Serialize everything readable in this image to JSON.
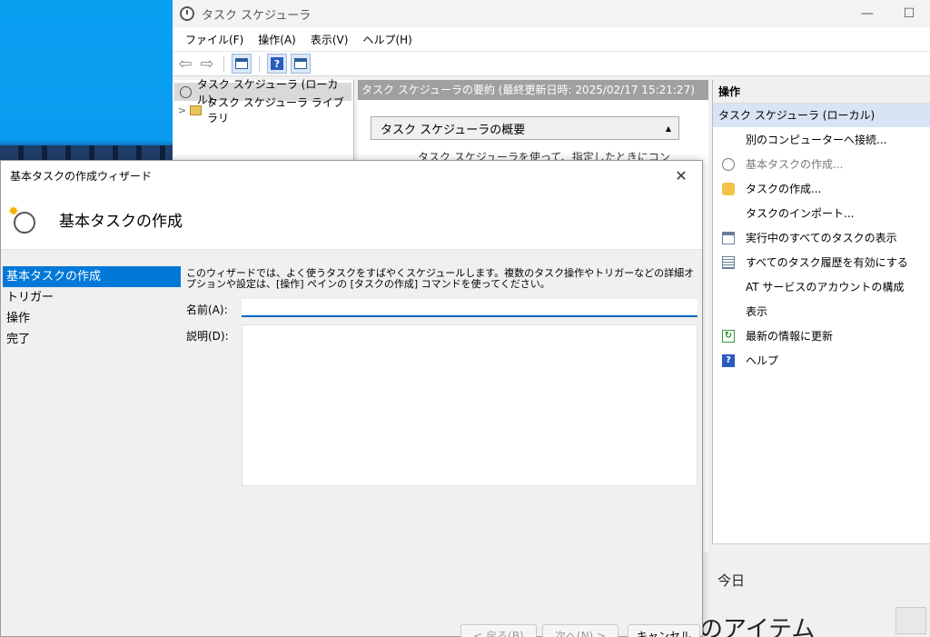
{
  "main_window": {
    "title": "タスク スケジューラ",
    "minimize": "—",
    "maximize": "☐"
  },
  "menu": [
    "ファイル(F)",
    "操作(A)",
    "表示(V)",
    "ヘルプ(H)"
  ],
  "toolbar": {
    "back": "⇦",
    "forward": "⇨",
    "help": "?"
  },
  "tree": {
    "root": "タスク スケジューラ (ローカル)",
    "library": "タスク スケジューラ ライブラリ"
  },
  "center": {
    "header": "タスク スケジューラの要約 (最終更新日時: 2025/02/17 15:21:27)",
    "overview_title": "タスク スケジューラの概要",
    "overview_text": "タスク スケジューラを使って、指定したときにコン",
    "today": "今日",
    "items_partial": "のアイテム"
  },
  "actions": {
    "header": "操作",
    "subheader": "タスク スケジューラ (ローカル)",
    "items": [
      {
        "label": "別のコンピューターへ接続...",
        "icon": "none"
      },
      {
        "label": "基本タスクの作成...",
        "icon": "clock-icon"
      },
      {
        "label": "タスクの作成...",
        "icon": "schedule-icon"
      },
      {
        "label": "タスクのインポート...",
        "icon": "none"
      },
      {
        "label": "実行中のすべてのタスクの表示",
        "icon": "list-icon"
      },
      {
        "label": "すべてのタスク履歴を有効にする",
        "icon": "history-icon"
      },
      {
        "label": "AT サービスのアカウントの構成",
        "icon": "none"
      },
      {
        "label": "表示",
        "icon": "none"
      },
      {
        "label": "最新の情報に更新",
        "icon": "refresh-icon"
      },
      {
        "label": "ヘルプ",
        "icon": "help-icon"
      }
    ]
  },
  "wizard": {
    "title": "基本タスクの作成ウィザード",
    "close": "✕",
    "header_title": "基本タスクの作成",
    "steps": [
      "基本タスクの作成",
      "トリガー",
      "操作",
      "完了"
    ],
    "description": "このウィザードでは、よく使うタスクをすばやくスケジュールします。複数のタスク操作やトリガーなどの詳細オプションや設定は、[操作] ペインの [タスクの作成] コマンドを使ってください。",
    "name_label": "名前(A):",
    "name_value": "",
    "desc_label": "説明(D):",
    "desc_value": "",
    "buttons": {
      "back": "< 戻る(B)",
      "next": "次へ(N) >",
      "cancel": "キャンセル"
    }
  },
  "colors": {
    "accent": "#0078d7",
    "actions_subheader": "#d8e4f3",
    "highlight_underline": "#e0722d"
  }
}
